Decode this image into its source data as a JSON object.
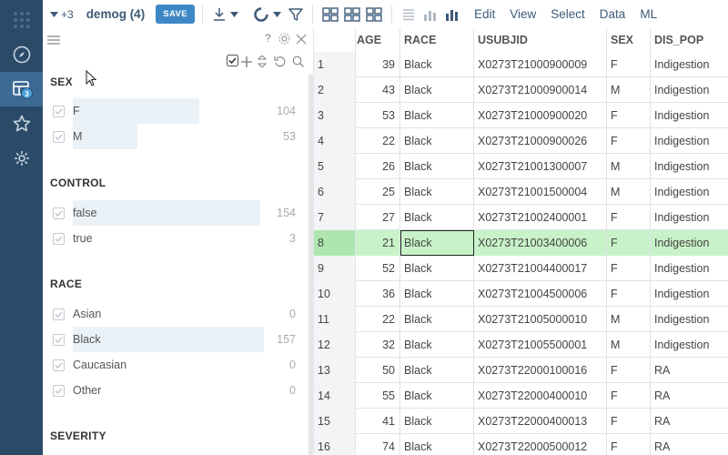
{
  "toolbar": {
    "expand_count": "+3",
    "table_title": "demog (4)",
    "save_label": "SAVE",
    "menu": [
      "Edit",
      "View",
      "Select",
      "Data",
      "ML"
    ]
  },
  "rail": {
    "badge": "3"
  },
  "filters": {
    "sections": [
      {
        "title": "SEX",
        "items": [
          {
            "label": "F",
            "count": "104",
            "fraction": 1.0
          },
          {
            "label": "M",
            "count": "53",
            "fraction": 0.51
          }
        ]
      },
      {
        "title": "CONTROL",
        "items": [
          {
            "label": "false",
            "count": "154",
            "fraction": 1.0
          },
          {
            "label": "true",
            "count": "3",
            "fraction": 0.0
          }
        ]
      },
      {
        "title": "RACE",
        "items": [
          {
            "label": "Asian",
            "count": "0",
            "fraction": 0.0
          },
          {
            "label": "Black",
            "count": "157",
            "fraction": 1.0
          },
          {
            "label": "Caucasian",
            "count": "0",
            "fraction": 0.0
          },
          {
            "label": "Other",
            "count": "0",
            "fraction": 0.0
          }
        ]
      },
      {
        "title": "SEVERITY",
        "items": []
      }
    ]
  },
  "grid": {
    "columns": [
      "",
      "AGE",
      "RACE",
      "USUBJID",
      "SEX",
      "DIS_POP"
    ],
    "selected_row": 8,
    "rows": [
      [
        "1",
        "39",
        "Black",
        "X0273T21000900009",
        "F",
        "Indigestion"
      ],
      [
        "2",
        "43",
        "Black",
        "X0273T21000900014",
        "M",
        "Indigestion"
      ],
      [
        "3",
        "53",
        "Black",
        "X0273T21000900020",
        "F",
        "Indigestion"
      ],
      [
        "4",
        "22",
        "Black",
        "X0273T21000900026",
        "F",
        "Indigestion"
      ],
      [
        "5",
        "26",
        "Black",
        "X0273T21001300007",
        "M",
        "Indigestion"
      ],
      [
        "6",
        "25",
        "Black",
        "X0273T21001500004",
        "M",
        "Indigestion"
      ],
      [
        "7",
        "27",
        "Black",
        "X0273T21002400001",
        "F",
        "Indigestion"
      ],
      [
        "8",
        "21",
        "Black",
        "X0273T21003400006",
        "F",
        "Indigestion"
      ],
      [
        "9",
        "52",
        "Black",
        "X0273T21004400017",
        "F",
        "Indigestion"
      ],
      [
        "10",
        "36",
        "Black",
        "X0273T21004500006",
        "F",
        "Indigestion"
      ],
      [
        "11",
        "22",
        "Black",
        "X0273T21005000010",
        "M",
        "Indigestion"
      ],
      [
        "12",
        "32",
        "Black",
        "X0273T21005500001",
        "M",
        "Indigestion"
      ],
      [
        "13",
        "50",
        "Black",
        "X0273T22000100016",
        "F",
        "RA"
      ],
      [
        "14",
        "55",
        "Black",
        "X0273T22000400010",
        "F",
        "RA"
      ],
      [
        "15",
        "41",
        "Black",
        "X0273T22000400013",
        "F",
        "RA"
      ],
      [
        "16",
        "74",
        "Black",
        "X0273T22000500012",
        "F",
        "RA"
      ]
    ]
  }
}
